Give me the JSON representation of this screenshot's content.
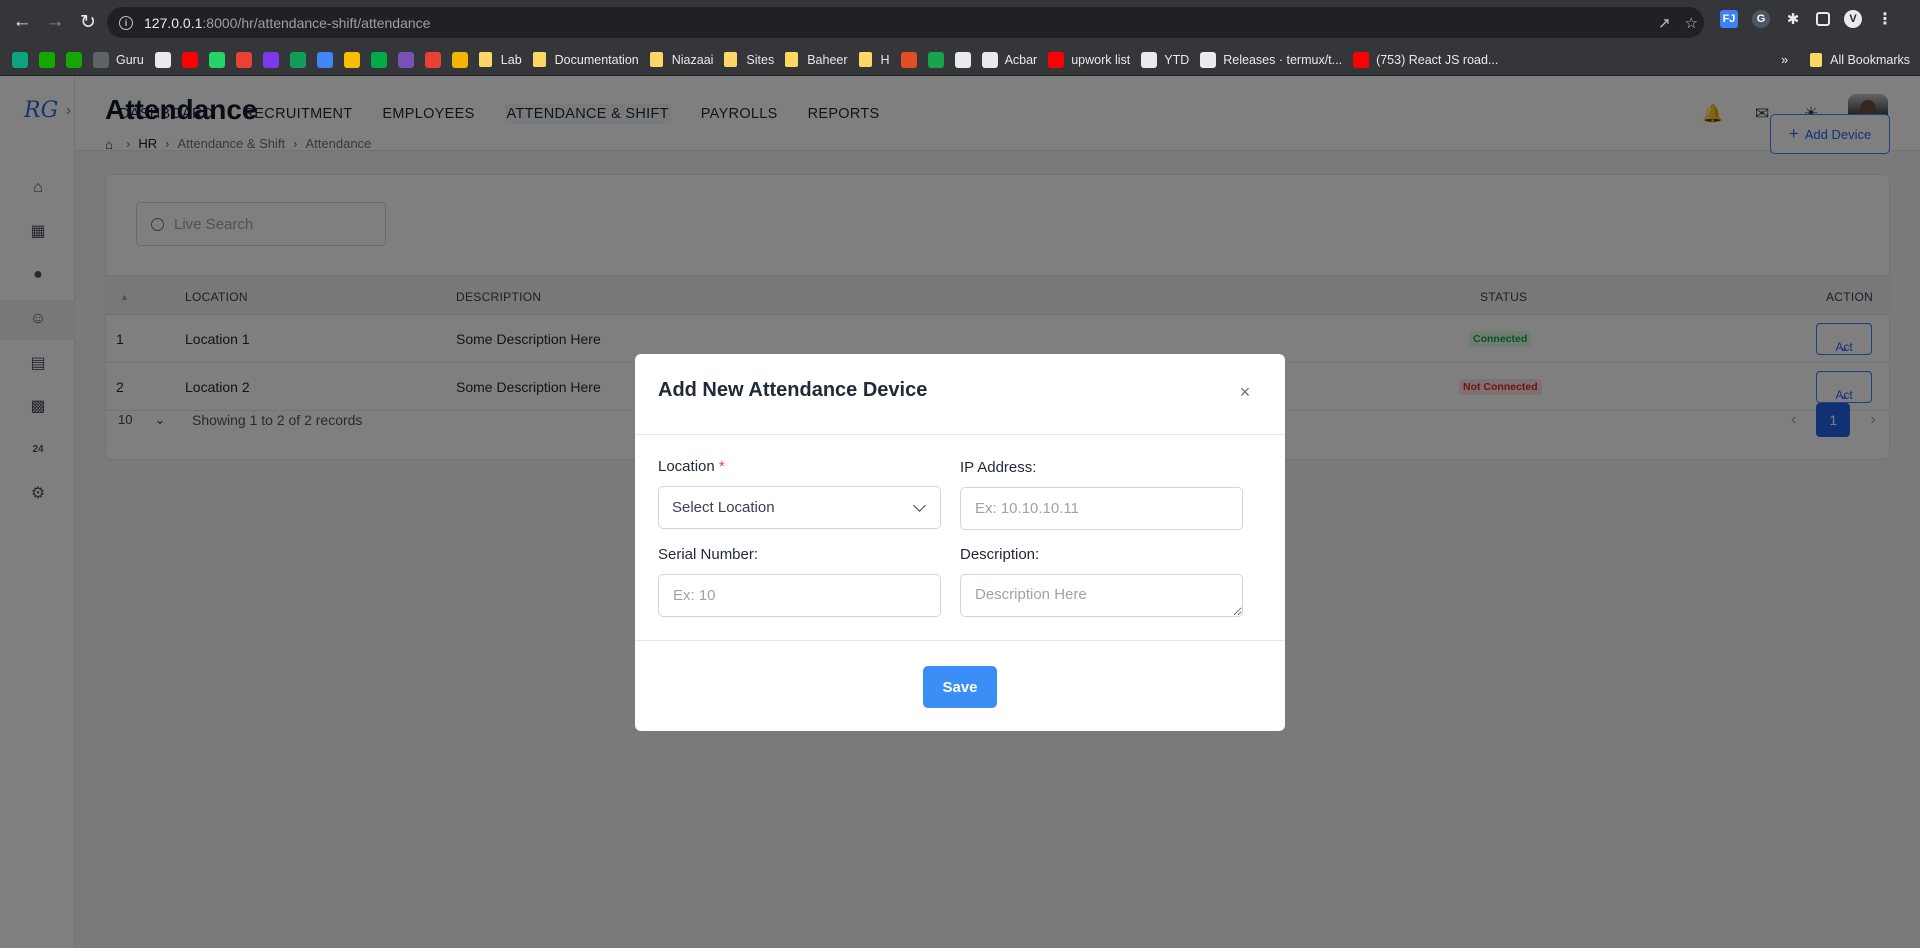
{
  "browser": {
    "url_host": "127.0.0.1",
    "url_rest": ":8000/hr/attendance-shift/attendance",
    "bookmarks": [
      {
        "label": "",
        "color": "#10a37f"
      },
      {
        "label": "",
        "color": "#14a800"
      },
      {
        "label": "",
        "color": "#14a800"
      },
      {
        "label": "Guru",
        "color": "#5f6368"
      },
      {
        "label": "",
        "color": "#e8eaed"
      },
      {
        "label": "",
        "color": "#ff0000"
      },
      {
        "label": "",
        "color": "#25d366"
      },
      {
        "label": "",
        "color": "#ea4335"
      },
      {
        "label": "",
        "color": "#7c3aed"
      },
      {
        "label": "",
        "color": "#0f9d58"
      },
      {
        "label": "",
        "color": "#4285f4"
      },
      {
        "label": "",
        "color": "#fbbc04"
      },
      {
        "label": "",
        "color": "#00ac47"
      },
      {
        "label": "",
        "color": "#7952b3"
      },
      {
        "label": "",
        "color": "#e94235"
      },
      {
        "label": "",
        "color": "#f4b400"
      },
      {
        "label": "Lab",
        "color": "folder"
      },
      {
        "label": "Documentation",
        "color": "folder"
      },
      {
        "label": "Niazaai",
        "color": "folder"
      },
      {
        "label": "Sites",
        "color": "folder"
      },
      {
        "label": "Baheer",
        "color": "folder"
      },
      {
        "label": "H",
        "color": "folder"
      },
      {
        "label": "",
        "color": "#e44d26"
      },
      {
        "label": "",
        "color": "#16a34a"
      },
      {
        "label": "",
        "color": "#e8eaed"
      },
      {
        "label": "Acbar",
        "color": "#e8eaed"
      },
      {
        "label": "upwork list",
        "color": "#ff0000"
      },
      {
        "label": "YTD",
        "color": "#e8eaed"
      },
      {
        "label": "Releases · termux/t...",
        "color": "#e8eaed"
      },
      {
        "label": "(753) React JS road...",
        "color": "#ff0000"
      }
    ],
    "all_bookmarks": "All Bookmarks"
  },
  "nav": {
    "items": [
      "DASHBOARD",
      "RECRUITMENT",
      "EMPLOYEES",
      "ATTENDANCE & SHIFT",
      "PAYROLLS",
      "REPORTS"
    ]
  },
  "page": {
    "title": "Attendance",
    "breadcrumb": [
      "HR",
      "Attendance & Shift",
      "Attendance"
    ],
    "add_device": "Add Device"
  },
  "table": {
    "search_placeholder": "Live Search",
    "headers": {
      "location": "LOCATION",
      "description": "DESCRIPTION",
      "status": "STATUS",
      "action": "ACTION"
    },
    "rows": [
      {
        "num": "1",
        "location": "Location 1",
        "description": "Some Description Here",
        "status": "Connected",
        "action": "Act"
      },
      {
        "num": "2",
        "location": "Location 2",
        "description": "Some Description Here",
        "status": "Not Connected",
        "action": "Act"
      }
    ],
    "page_size": "10",
    "info": "Showing 1 to 2 of 2 records",
    "current_page": "1"
  },
  "modal": {
    "title": "Add New Attendance Device",
    "location_label": "Location",
    "location_value": "Select Location",
    "ip_label": "IP Address:",
    "ip_placeholder": "Ex: 10.10.10.11",
    "serial_label": "Serial Number:",
    "serial_placeholder": "Ex: 10",
    "desc_label": "Description:",
    "desc_placeholder": "Description Here",
    "save": "Save"
  },
  "colors": {
    "primary": "#2563eb",
    "save": "#3b8ef5",
    "connected": "#16a34a",
    "not_connected": "#dc2626"
  }
}
